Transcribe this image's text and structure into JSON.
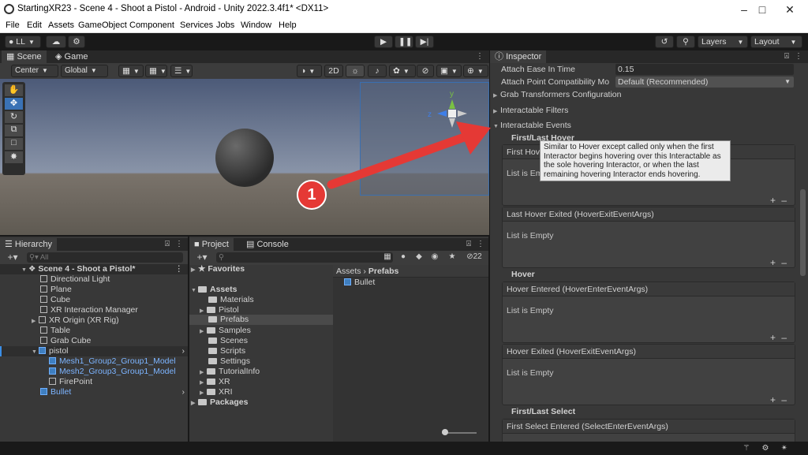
{
  "window": {
    "title": "StartingXR23 - Scene 4 - Shoot a Pistol - Android - Unity 2022.3.4f1* <DX11>"
  },
  "menu": [
    "File",
    "Edit",
    "Assets",
    "GameObject",
    "Component",
    "Services",
    "Jobs",
    "Window",
    "Help"
  ],
  "toolbar": {
    "account": "LL",
    "layers": "Layers",
    "layout": "Layout"
  },
  "scene_panel": {
    "tabs": [
      "Scene",
      "Game"
    ],
    "pivot": "Center",
    "space": "Global",
    "mode_2d": "2D",
    "axes": {
      "y": "y",
      "z": "z"
    }
  },
  "hierarchy": {
    "tab": "Hierarchy",
    "search_placeholder": "All",
    "items": [
      {
        "label": "Scene 4 - Shoot a Pistol*",
        "type": "scene"
      },
      {
        "label": "Directional Light",
        "type": "obj"
      },
      {
        "label": "Plane",
        "type": "obj"
      },
      {
        "label": "Cube",
        "type": "obj"
      },
      {
        "label": "XR Interaction Manager",
        "type": "obj"
      },
      {
        "label": "XR Origin (XR Rig)",
        "type": "obj"
      },
      {
        "label": "Table",
        "type": "obj"
      },
      {
        "label": "Grab Cube",
        "type": "obj"
      },
      {
        "label": "pistol",
        "type": "prefab"
      },
      {
        "label": "Mesh1_Group2_Group1_Model",
        "type": "prefab-child"
      },
      {
        "label": "Mesh2_Group3_Group1_Model",
        "type": "prefab-child"
      },
      {
        "label": "FirePoint",
        "type": "obj"
      },
      {
        "label": "Bullet",
        "type": "prefab"
      }
    ]
  },
  "project": {
    "tabs": [
      "Project",
      "Console"
    ],
    "hidden_count": "22",
    "tree": [
      "Favorites",
      "Assets",
      "Materials",
      "Pistol",
      "Prefabs",
      "Samples",
      "Scenes",
      "Scripts",
      "Settings",
      "TutorialInfo",
      "XR",
      "XRI",
      "Packages"
    ],
    "breadcrumb": [
      "Assets",
      "Prefabs"
    ],
    "files": [
      "Bullet"
    ]
  },
  "inspector": {
    "tab": "Inspector",
    "attach_ease_label": "Attach Ease In Time",
    "attach_ease_value": "0.15",
    "attach_point_label": "Attach Point Compatibility Mo",
    "attach_point_value": "Default (Recommended)",
    "foldouts": [
      "Grab Transformers Configuration",
      "Interactable Filters",
      "Interactable Events"
    ],
    "sections": {
      "first_last_hover": "First/Last Hover",
      "hover": "Hover",
      "first_last_select": "First/Last Select"
    },
    "events": [
      {
        "label": "First Hover Entered (HoverEnterEventArgs)",
        "visible_label": "First Hov",
        "body": "List is Empty",
        "visible_body": "List is Em"
      },
      {
        "label": "Last Hover Exited (HoverExitEventArgs)",
        "body": "List is Empty"
      },
      {
        "label": "Hover Entered (HoverEnterEventArgs)",
        "body": "List is Empty"
      },
      {
        "label": "Hover Exited (HoverExitEventArgs)",
        "body": "List is Empty"
      },
      {
        "label": "First Select Entered (SelectEnterEventArgs)"
      }
    ],
    "tooltip": "Similar to Hover except called only when the first Interactor begins hovering over this Interactable as the sole hovering Interactor, or when the last remaining hovering Interactor ends hovering."
  },
  "annotation": {
    "number": "1",
    "color": "#e53935"
  }
}
